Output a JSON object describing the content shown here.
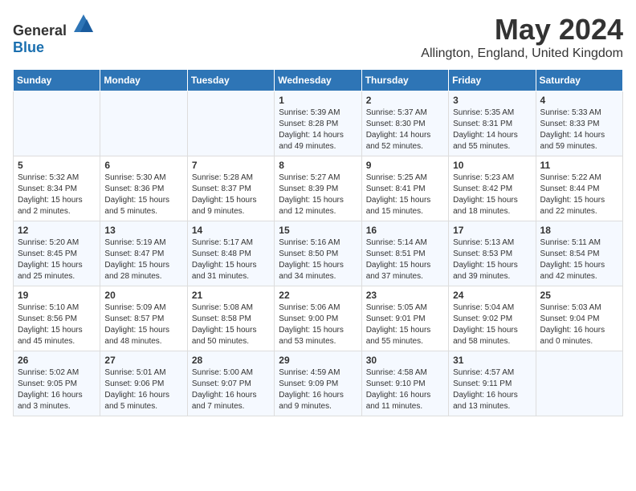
{
  "logo": {
    "general": "General",
    "blue": "Blue"
  },
  "title": "May 2024",
  "subtitle": "Allington, England, United Kingdom",
  "days_of_week": [
    "Sunday",
    "Monday",
    "Tuesday",
    "Wednesday",
    "Thursday",
    "Friday",
    "Saturday"
  ],
  "weeks": [
    [
      {
        "day": "",
        "info": ""
      },
      {
        "day": "",
        "info": ""
      },
      {
        "day": "",
        "info": ""
      },
      {
        "day": "1",
        "info": "Sunrise: 5:39 AM\nSunset: 8:28 PM\nDaylight: 14 hours\nand 49 minutes."
      },
      {
        "day": "2",
        "info": "Sunrise: 5:37 AM\nSunset: 8:30 PM\nDaylight: 14 hours\nand 52 minutes."
      },
      {
        "day": "3",
        "info": "Sunrise: 5:35 AM\nSunset: 8:31 PM\nDaylight: 14 hours\nand 55 minutes."
      },
      {
        "day": "4",
        "info": "Sunrise: 5:33 AM\nSunset: 8:33 PM\nDaylight: 14 hours\nand 59 minutes."
      }
    ],
    [
      {
        "day": "5",
        "info": "Sunrise: 5:32 AM\nSunset: 8:34 PM\nDaylight: 15 hours\nand 2 minutes."
      },
      {
        "day": "6",
        "info": "Sunrise: 5:30 AM\nSunset: 8:36 PM\nDaylight: 15 hours\nand 5 minutes."
      },
      {
        "day": "7",
        "info": "Sunrise: 5:28 AM\nSunset: 8:37 PM\nDaylight: 15 hours\nand 9 minutes."
      },
      {
        "day": "8",
        "info": "Sunrise: 5:27 AM\nSunset: 8:39 PM\nDaylight: 15 hours\nand 12 minutes."
      },
      {
        "day": "9",
        "info": "Sunrise: 5:25 AM\nSunset: 8:41 PM\nDaylight: 15 hours\nand 15 minutes."
      },
      {
        "day": "10",
        "info": "Sunrise: 5:23 AM\nSunset: 8:42 PM\nDaylight: 15 hours\nand 18 minutes."
      },
      {
        "day": "11",
        "info": "Sunrise: 5:22 AM\nSunset: 8:44 PM\nDaylight: 15 hours\nand 22 minutes."
      }
    ],
    [
      {
        "day": "12",
        "info": "Sunrise: 5:20 AM\nSunset: 8:45 PM\nDaylight: 15 hours\nand 25 minutes."
      },
      {
        "day": "13",
        "info": "Sunrise: 5:19 AM\nSunset: 8:47 PM\nDaylight: 15 hours\nand 28 minutes."
      },
      {
        "day": "14",
        "info": "Sunrise: 5:17 AM\nSunset: 8:48 PM\nDaylight: 15 hours\nand 31 minutes."
      },
      {
        "day": "15",
        "info": "Sunrise: 5:16 AM\nSunset: 8:50 PM\nDaylight: 15 hours\nand 34 minutes."
      },
      {
        "day": "16",
        "info": "Sunrise: 5:14 AM\nSunset: 8:51 PM\nDaylight: 15 hours\nand 37 minutes."
      },
      {
        "day": "17",
        "info": "Sunrise: 5:13 AM\nSunset: 8:53 PM\nDaylight: 15 hours\nand 39 minutes."
      },
      {
        "day": "18",
        "info": "Sunrise: 5:11 AM\nSunset: 8:54 PM\nDaylight: 15 hours\nand 42 minutes."
      }
    ],
    [
      {
        "day": "19",
        "info": "Sunrise: 5:10 AM\nSunset: 8:56 PM\nDaylight: 15 hours\nand 45 minutes."
      },
      {
        "day": "20",
        "info": "Sunrise: 5:09 AM\nSunset: 8:57 PM\nDaylight: 15 hours\nand 48 minutes."
      },
      {
        "day": "21",
        "info": "Sunrise: 5:08 AM\nSunset: 8:58 PM\nDaylight: 15 hours\nand 50 minutes."
      },
      {
        "day": "22",
        "info": "Sunrise: 5:06 AM\nSunset: 9:00 PM\nDaylight: 15 hours\nand 53 minutes."
      },
      {
        "day": "23",
        "info": "Sunrise: 5:05 AM\nSunset: 9:01 PM\nDaylight: 15 hours\nand 55 minutes."
      },
      {
        "day": "24",
        "info": "Sunrise: 5:04 AM\nSunset: 9:02 PM\nDaylight: 15 hours\nand 58 minutes."
      },
      {
        "day": "25",
        "info": "Sunrise: 5:03 AM\nSunset: 9:04 PM\nDaylight: 16 hours\nand 0 minutes."
      }
    ],
    [
      {
        "day": "26",
        "info": "Sunrise: 5:02 AM\nSunset: 9:05 PM\nDaylight: 16 hours\nand 3 minutes."
      },
      {
        "day": "27",
        "info": "Sunrise: 5:01 AM\nSunset: 9:06 PM\nDaylight: 16 hours\nand 5 minutes."
      },
      {
        "day": "28",
        "info": "Sunrise: 5:00 AM\nSunset: 9:07 PM\nDaylight: 16 hours\nand 7 minutes."
      },
      {
        "day": "29",
        "info": "Sunrise: 4:59 AM\nSunset: 9:09 PM\nDaylight: 16 hours\nand 9 minutes."
      },
      {
        "day": "30",
        "info": "Sunrise: 4:58 AM\nSunset: 9:10 PM\nDaylight: 16 hours\nand 11 minutes."
      },
      {
        "day": "31",
        "info": "Sunrise: 4:57 AM\nSunset: 9:11 PM\nDaylight: 16 hours\nand 13 minutes."
      },
      {
        "day": "",
        "info": ""
      }
    ]
  ]
}
